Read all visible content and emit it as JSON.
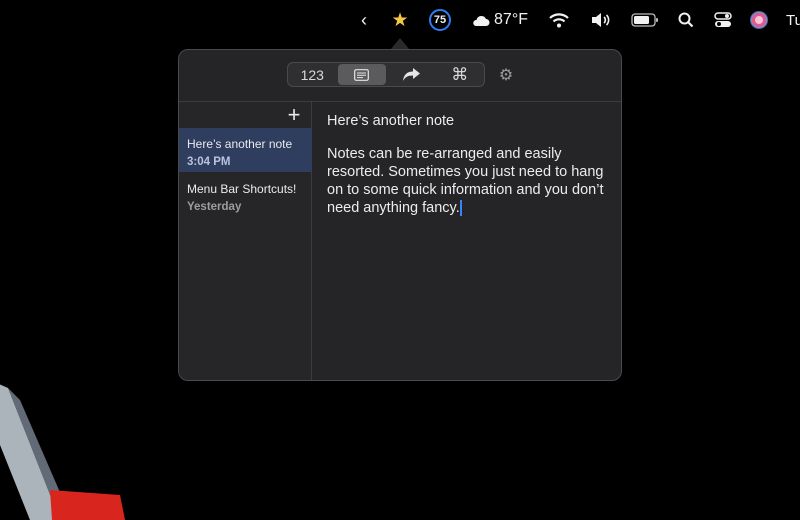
{
  "menubar": {
    "weather_temp": "87°F",
    "battery_badge": "75",
    "clock_partial": "Tu",
    "icons": [
      "chevron-left-icon",
      "star-icon",
      "circle-badge-icon",
      "cloud-icon",
      "wifi-icon",
      "volume-icon",
      "battery-icon",
      "search-icon",
      "control-center-icon",
      "siri-icon"
    ]
  },
  "toolbar": {
    "segments": [
      {
        "label": "123",
        "icon": "numbers"
      },
      {
        "label": "",
        "icon": "notes-icon",
        "active": true
      },
      {
        "label": "",
        "icon": "share-arrow-icon"
      },
      {
        "label": "⌘",
        "icon": "command-icon"
      }
    ],
    "settings_icon": "gear-icon"
  },
  "sidebar": {
    "add_icon": "plus-icon",
    "notes": [
      {
        "title": "Here’s another note",
        "time": "3:04 PM",
        "selected": true
      },
      {
        "title": "Menu Bar Shortcuts!",
        "time": "Yesterday",
        "selected": false
      }
    ]
  },
  "editor": {
    "title": "Here’s another note",
    "body": "Notes can be re-arranged and easily resorted. Sometimes you just need to hang on to some quick information and you don’t need anything fancy."
  }
}
